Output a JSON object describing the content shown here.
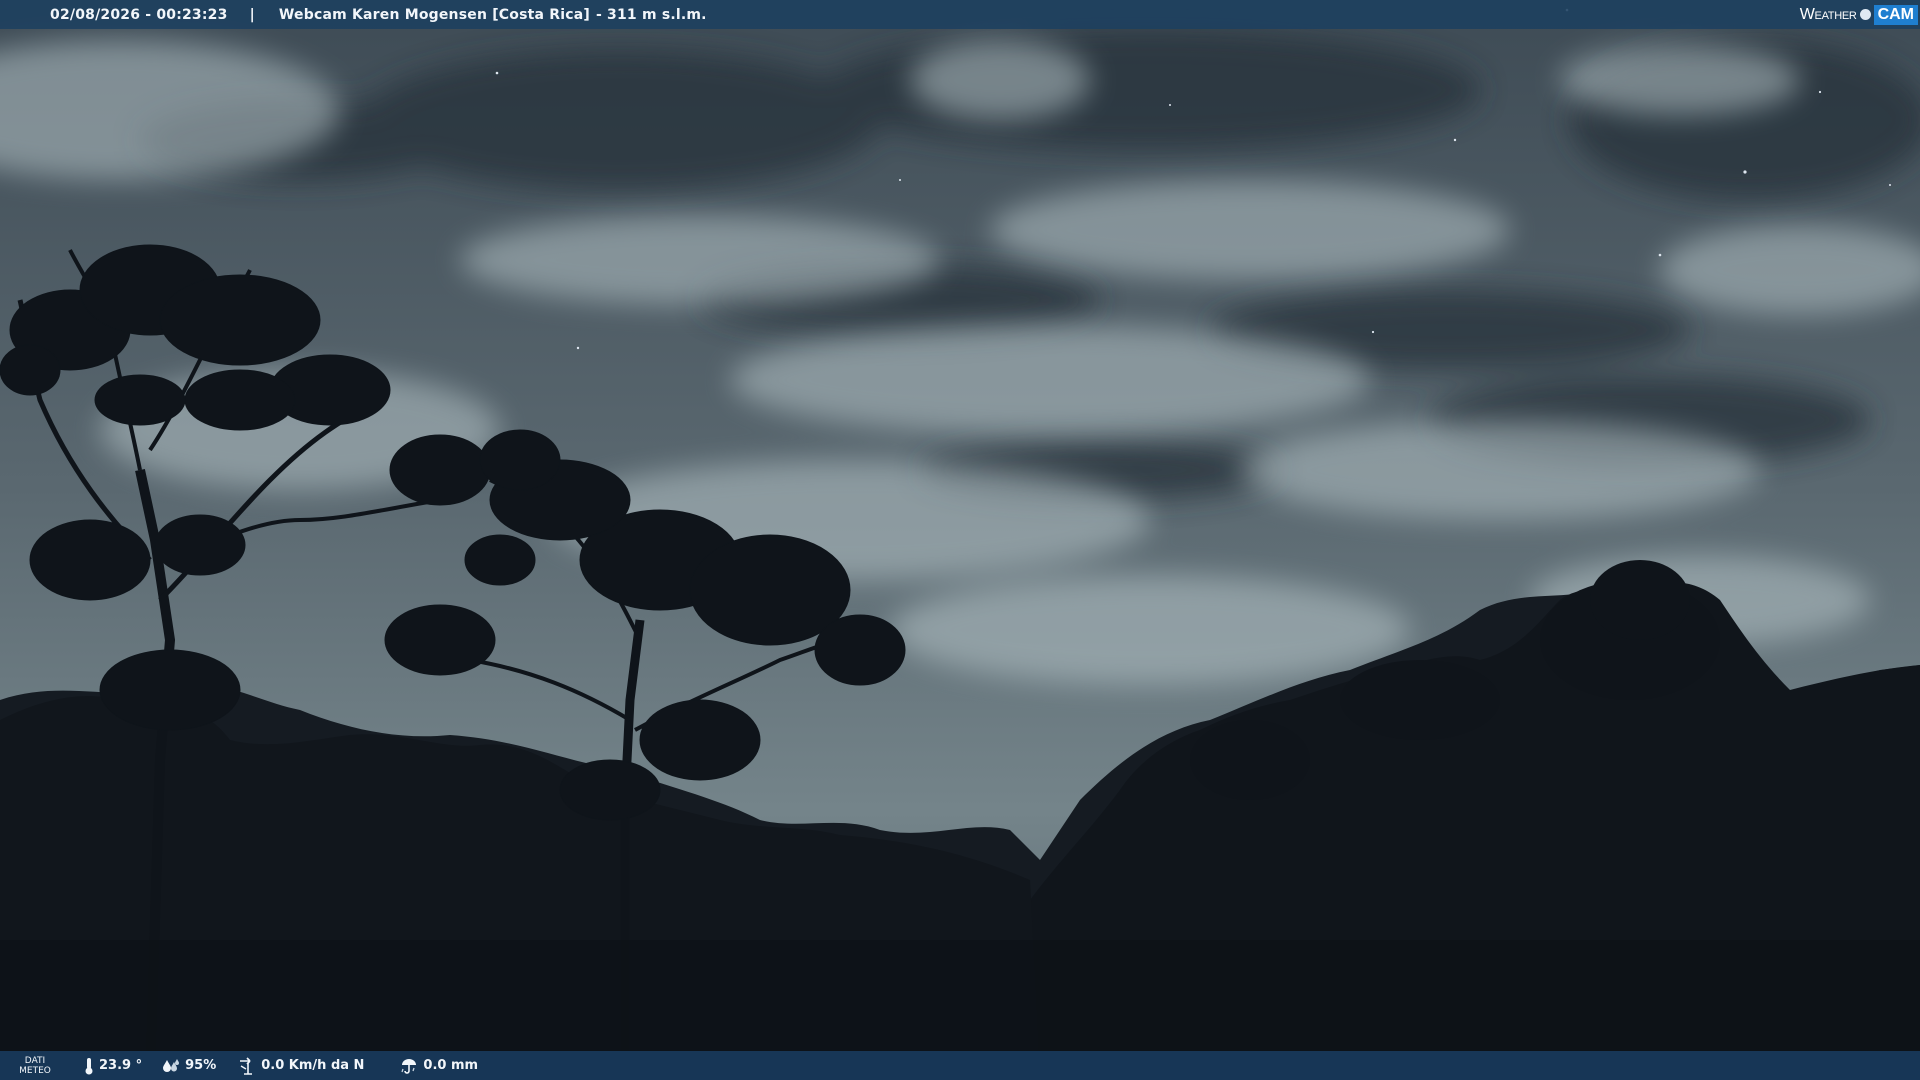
{
  "header": {
    "datetime": "02/08/2026 - 00:23:23",
    "separator": "|",
    "camera_title": "Webcam Karen Mogensen [Costa Rica]",
    "altitude": "- 311 m s.l.m."
  },
  "brand": {
    "weather_text": "Weather",
    "cam_text": "CAM"
  },
  "weather_panel": {
    "label_line1": "DATI",
    "label_line2": "METEO",
    "temperature": "23.9 °",
    "humidity": "95%",
    "wind": "0.0 Km/h da N",
    "rain": "0.0 mm"
  },
  "colors": {
    "bar_background": "#1c4060",
    "brand_accent": "#1f7fd0",
    "text": "#f2f6fa"
  },
  "icons": {
    "temperature": "thermometer-icon",
    "humidity": "droplets-icon",
    "wind": "wind-vane-icon",
    "rain": "rain-gauge-icon"
  }
}
